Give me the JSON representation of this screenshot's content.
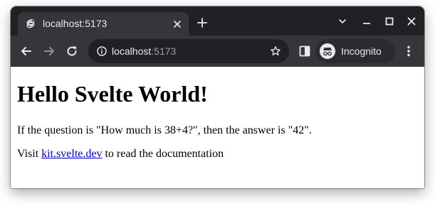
{
  "tab": {
    "title": "localhost:5173",
    "favicon": "svelte-logo-icon"
  },
  "toolbar": {
    "url_host": "localhost",
    "url_port": ":5173",
    "profile_label": "Incognito"
  },
  "page": {
    "heading": "Hello Svelte World!",
    "answer_line": "If the question is \"How much is 38+4?\", then the answer is \"42\".",
    "visit_prefix": "Visit ",
    "link_text": "kit.svelte.dev",
    "visit_suffix": " to read the documentation"
  },
  "colors": {
    "tabstrip_bg": "#202124",
    "toolbar_bg": "#35363a",
    "link": "#0000ee"
  }
}
